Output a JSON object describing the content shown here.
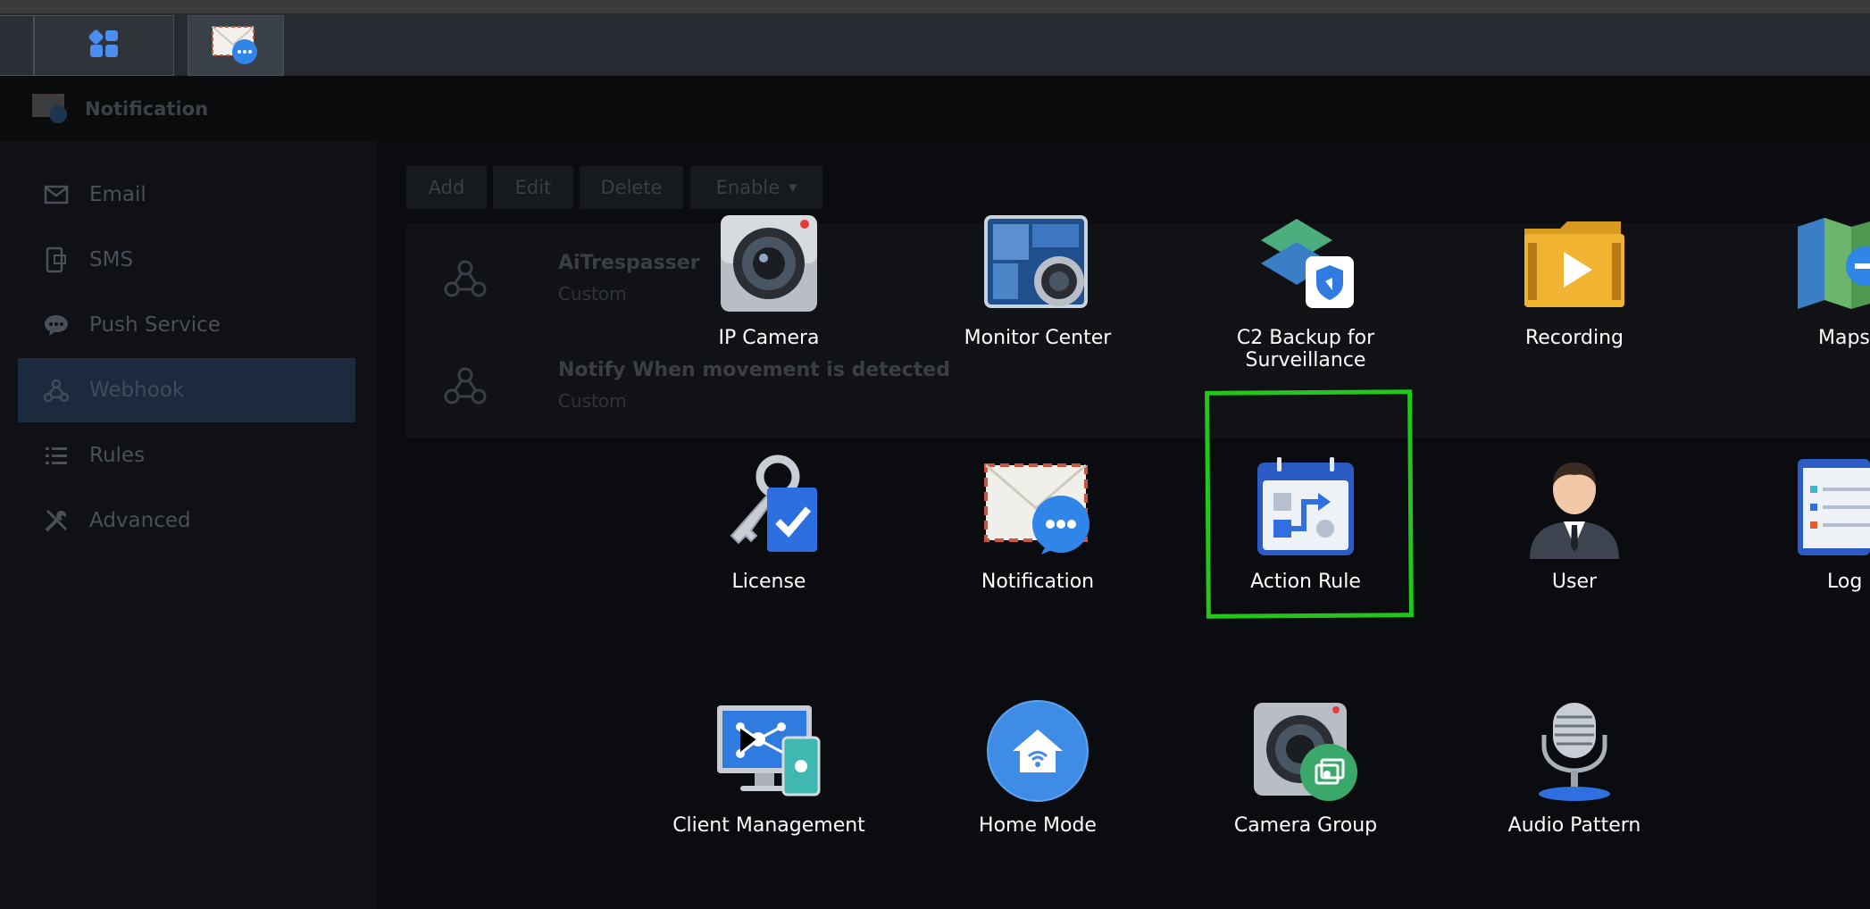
{
  "taskbar": {
    "buttons": [
      {
        "name": "main-menu",
        "icon": "grid-icon"
      },
      {
        "name": "notification-app",
        "icon": "notification-envelope-icon"
      }
    ]
  },
  "window": {
    "title": "Notification",
    "sidebar": {
      "items": [
        {
          "label": "Email",
          "icon": "envelope-icon"
        },
        {
          "label": "SMS",
          "icon": "phone-icon"
        },
        {
          "label": "Push Service",
          "icon": "chat-bubble-icon"
        },
        {
          "label": "Webhook",
          "icon": "webhook-icon",
          "active": true
        },
        {
          "label": "Rules",
          "icon": "list-icon"
        },
        {
          "label": "Advanced",
          "icon": "tools-icon"
        }
      ]
    },
    "toolbar": {
      "add": "Add",
      "edit": "Edit",
      "delete": "Delete",
      "enable": "Enable"
    },
    "webhooks": [
      {
        "name": "AiTrespasser",
        "type": "Custom"
      },
      {
        "name": "Notify When movement is detected",
        "type": "Custom"
      }
    ]
  },
  "apps": [
    {
      "label": "IP Camera",
      "icon": "ip-camera-icon"
    },
    {
      "label": "Monitor Center",
      "icon": "monitor-center-icon"
    },
    {
      "label": "C2 Backup for Surveillance",
      "icon": "c2-backup-icon"
    },
    {
      "label": "Recording",
      "icon": "recording-folder-icon"
    },
    {
      "label": "Maps",
      "icon": "maps-icon"
    },
    {
      "label": "License",
      "icon": "license-key-icon"
    },
    {
      "label": "Notification",
      "icon": "notification-envelope-icon"
    },
    {
      "label": "Action Rule",
      "icon": "action-rule-calendar-icon",
      "highlighted": true
    },
    {
      "label": "User",
      "icon": "user-icon"
    },
    {
      "label": "Log",
      "icon": "log-icon"
    },
    {
      "label": "Client Management",
      "icon": "client-management-icon"
    },
    {
      "label": "Home Mode",
      "icon": "home-mode-icon"
    },
    {
      "label": "Camera Group",
      "icon": "camera-group-icon"
    },
    {
      "label": "Audio Pattern",
      "icon": "microphone-icon"
    }
  ],
  "colors": {
    "highlight": "#22c71a",
    "active_sidebar": "#1b2a3c",
    "accent_blue": "#3d7cf0"
  }
}
